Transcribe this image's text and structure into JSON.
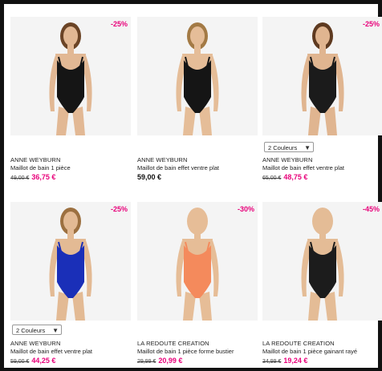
{
  "products": [
    {
      "brand": "ANNE WEYBURN",
      "name": "Maillot de bain 1 pièce",
      "old_price": "49,00 €",
      "price": "36,75 €",
      "discount": "-25%",
      "colors_label": "",
      "swim_color": "#151515",
      "skin_color": "#e2b894",
      "hair_color": "#6b4426"
    },
    {
      "brand": "ANNE WEYBURN",
      "name": "Maillot de bain effet ventre plat",
      "old_price": "",
      "price": "59,00 €",
      "discount": "",
      "colors_label": "",
      "swim_color": "#151515",
      "skin_color": "#e5bd98",
      "hair_color": "#a37a45"
    },
    {
      "brand": "ANNE WEYBURN",
      "name": "Maillot de bain effet ventre plat",
      "old_price": "65,00 €",
      "price": "48,75 €",
      "discount": "-25%",
      "colors_label": "2 Couleurs",
      "swim_color": "#1b1b1b",
      "skin_color": "#e0b590",
      "hair_color": "#5e3a20"
    },
    {
      "brand": "ANNE WEYBURN",
      "name": "Maillot de bain effet ventre plat",
      "old_price": "59,00 €",
      "price": "44,25 €",
      "discount": "-25%",
      "colors_label": "2 Couleurs",
      "swim_color": "#1a2fb8",
      "skin_color": "#e3ba94",
      "hair_color": "#9c7040"
    },
    {
      "brand": "LA REDOUTE CREATION",
      "name": "Maillot de bain 1 pièce forme bustier",
      "old_price": "29,99 €",
      "price": "20,99 €",
      "discount": "-30%",
      "colors_label": "",
      "swim_color": "#f48a5c",
      "skin_color": "#e6bd97",
      "hair_color": "#e6bd97"
    },
    {
      "brand": "LA REDOUTE CREATION",
      "name": "Maillot de bain 1 pièce gainant rayé",
      "old_price": "34,99 €",
      "price": "19,24 €",
      "discount": "-45%",
      "colors_label": "",
      "swim_color": "#1c1c1c",
      "skin_color": "#e4bc96",
      "hair_color": "#e4bc96"
    }
  ]
}
